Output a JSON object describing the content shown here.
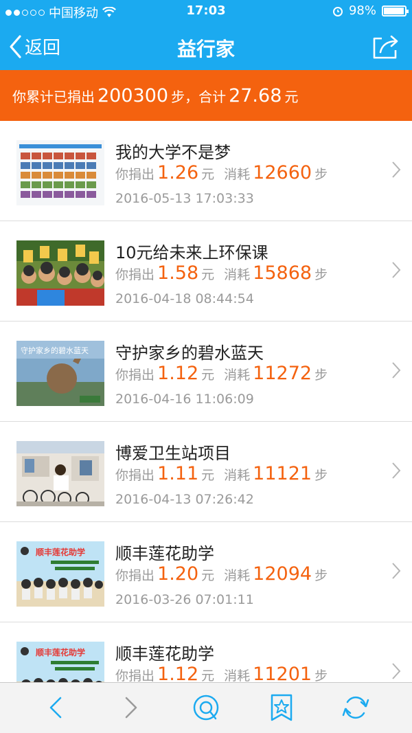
{
  "status_bar": {
    "carrier": "中国移动",
    "time": "17:03",
    "battery": "98%"
  },
  "nav": {
    "back_label": "返回",
    "title": "益行家"
  },
  "summary": {
    "prefix": "你累计已捐出",
    "steps": "200300",
    "mid": "步，合计",
    "amount": "27.68",
    "suffix": "元"
  },
  "labels": {
    "donated": "你捐出",
    "yuan": "元",
    "consumed": "消耗",
    "steps": "步"
  },
  "items": [
    {
      "title": "我的大学不是梦",
      "amount": "1.26",
      "steps": "12660",
      "date": "2016-05-13 17:03:33"
    },
    {
      "title": "10元给未来上环保课",
      "amount": "1.58",
      "steps": "15868",
      "date": "2016-04-18 08:44:54"
    },
    {
      "title": "守护家乡的碧水蓝天",
      "amount": "1.12",
      "steps": "11272",
      "date": "2016-04-16 11:06:09",
      "thumb_text": "守护家乡的碧水蓝天"
    },
    {
      "title": "博爱卫生站项目",
      "amount": "1.11",
      "steps": "11121",
      "date": "2016-04-13 07:26:42"
    },
    {
      "title": "顺丰莲花助学",
      "amount": "1.20",
      "steps": "12094",
      "date": "2016-03-26 07:01:11",
      "thumb_text": "顺丰莲花助学"
    },
    {
      "title": "顺丰莲花助学",
      "amount": "1.12",
      "steps": "11201",
      "date": ""
    }
  ],
  "colors": {
    "header": "#1baaf0",
    "accent": "#f4620f"
  }
}
